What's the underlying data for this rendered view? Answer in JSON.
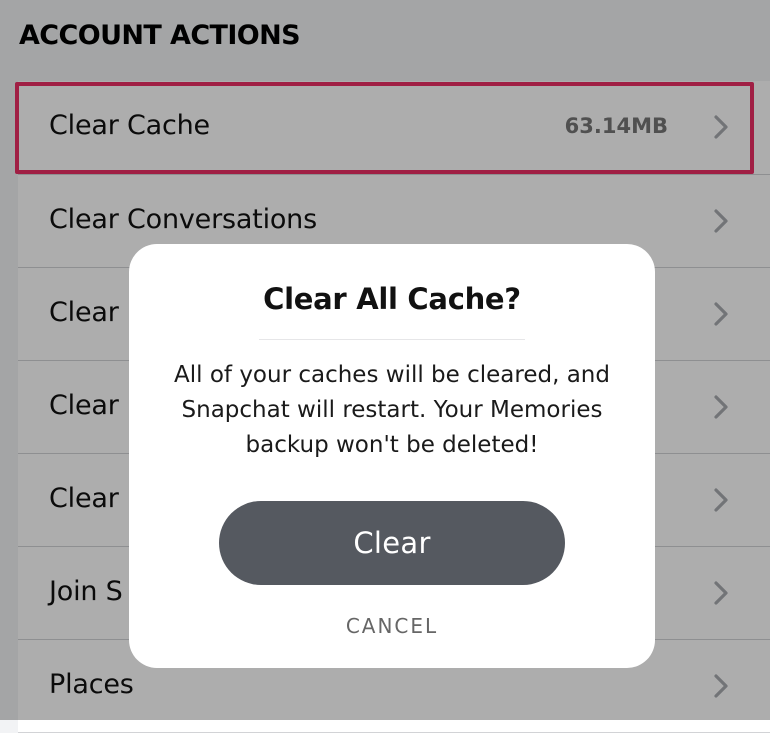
{
  "section_header": "ACCOUNT ACTIONS",
  "rows": [
    {
      "label": "Clear Cache",
      "value": "63.14MB"
    },
    {
      "label": "Clear Conversations",
      "value": ""
    },
    {
      "label": "Clear",
      "value": ""
    },
    {
      "label": "Clear",
      "value": ""
    },
    {
      "label": "Clear",
      "value": ""
    },
    {
      "label": "Join S",
      "value": ""
    },
    {
      "label": "Places",
      "value": ""
    }
  ],
  "dialog": {
    "title": "Clear All Cache?",
    "body": "All of your caches will be cleared, and Snapchat will restart. Your Memories backup won't be deleted!",
    "confirm_label": "Clear",
    "cancel_label": "CANCEL"
  },
  "icons": {
    "row_chevron": "chevron-right-icon"
  },
  "colors": {
    "highlight": "#ec2e65",
    "primary_button": "#555960"
  }
}
